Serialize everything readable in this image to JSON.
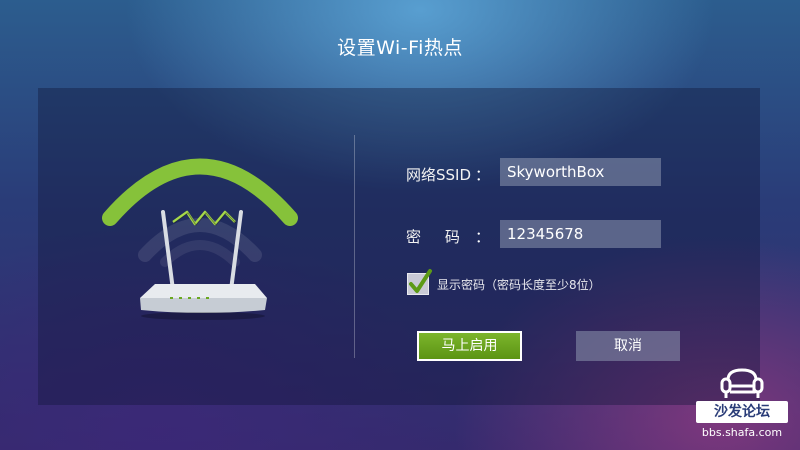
{
  "page": {
    "title": "设置Wi-Fi热点"
  },
  "form": {
    "ssid_label": "网络SSID",
    "ssid_colon": "：",
    "ssid_value": "SkyworthBox",
    "password_label": "密     码",
    "password_colon": "：",
    "password_value": "12345678",
    "show_password_checked": true,
    "show_password_label": "显示密码（密码长度至少8位）"
  },
  "buttons": {
    "start_label": "马上启用",
    "cancel_label": "取消"
  },
  "watermark": {
    "brand": "沙发论坛",
    "site": "bbs.shafa.com"
  },
  "colors": {
    "accent_green": "#6aa81f",
    "input_bg": "#8c96af"
  },
  "icons": {
    "illustration": "wifi-router-icon",
    "checkbox": "checkmark-icon",
    "watermark": "sofa-icon"
  }
}
